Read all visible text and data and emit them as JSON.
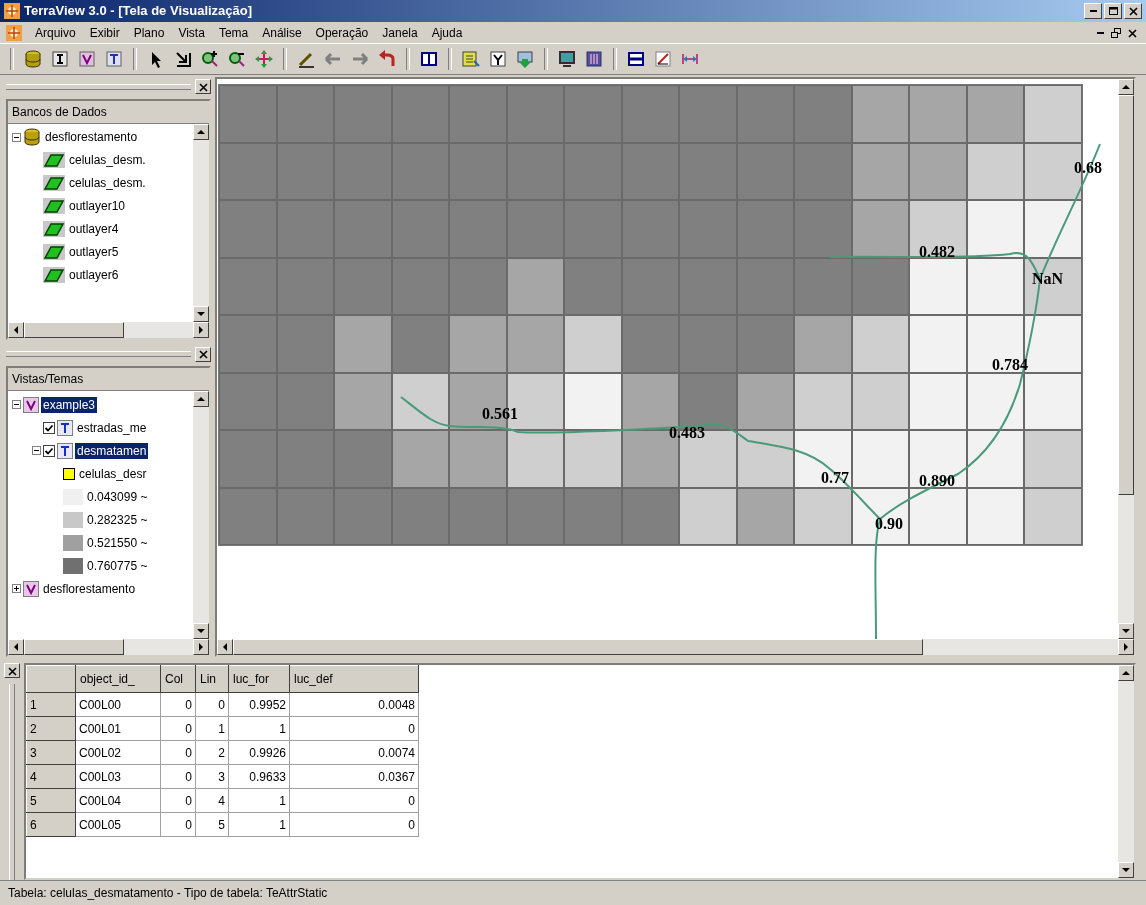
{
  "window": {
    "title": "TerraView 3.0 - [Tela de Visualização]"
  },
  "menu": [
    "Arquivo",
    "Exibir",
    "Plano",
    "Vista",
    "Tema",
    "Análise",
    "Operação",
    "Janela",
    "Ajuda"
  ],
  "databases": {
    "title": "Bancos de Dados",
    "items": [
      {
        "kind": "database",
        "label": "desflorestamento",
        "expanded": true,
        "selected": false,
        "children": [
          {
            "kind": "layer",
            "label": "celulas_desm.",
            "selected": false
          },
          {
            "kind": "layer",
            "label": "celulas_desm.",
            "selected": false
          },
          {
            "kind": "layer",
            "label": "outlayer10",
            "selected": false
          },
          {
            "kind": "layer",
            "label": "outlayer4",
            "selected": false
          },
          {
            "kind": "layer",
            "label": "outlayer5",
            "selected": false
          },
          {
            "kind": "layer",
            "label": "outlayer6",
            "selected": false
          }
        ]
      }
    ]
  },
  "views": {
    "title": "Vistas/Temas",
    "items": [
      {
        "kind": "view",
        "label": "example3",
        "expanded": true,
        "selected": true,
        "children": [
          {
            "kind": "theme",
            "label": "estradas_me",
            "checked": true,
            "selected": false
          },
          {
            "kind": "theme",
            "label": "desmatamen",
            "checked": true,
            "expanded": true,
            "selected": true,
            "children": [
              {
                "kind": "legend",
                "label": "celulas_desr",
                "color": "#ffff00"
              },
              {
                "kind": "legend",
                "label": "0.043099 ~",
                "color": "#f0f0f0"
              },
              {
                "kind": "legend",
                "label": "0.282325 ~",
                "color": "#c8c8c8"
              },
              {
                "kind": "legend",
                "label": "0.521550 ~",
                "color": "#a0a0a0"
              },
              {
                "kind": "legend",
                "label": "0.760775 ~",
                "color": "#707070"
              }
            ]
          }
        ]
      },
      {
        "kind": "view",
        "label": "desflorestamento",
        "expanded": false,
        "selected": false
      }
    ]
  },
  "map": {
    "rows": [
      {
        "cells": [
          {
            "color": "#808080"
          },
          {
            "color": "#808080"
          },
          {
            "color": "#808080"
          },
          {
            "color": "#808080"
          },
          {
            "color": "#808080"
          },
          {
            "color": "#808080"
          },
          {
            "color": "#808080"
          },
          {
            "color": "#808080"
          },
          {
            "color": "#808080"
          },
          {
            "color": "#808080"
          },
          {
            "color": "#808080"
          },
          {
            "color": "#a6a6a6"
          },
          {
            "color": "#a6a6a6"
          },
          {
            "color": "#a6a6a6"
          },
          {
            "color": "#cfcfcf"
          }
        ]
      },
      {
        "cells": [
          {
            "color": "#808080"
          },
          {
            "color": "#808080"
          },
          {
            "color": "#808080"
          },
          {
            "color": "#808080"
          },
          {
            "color": "#808080"
          },
          {
            "color": "#808080"
          },
          {
            "color": "#808080"
          },
          {
            "color": "#808080"
          },
          {
            "color": "#808080"
          },
          {
            "color": "#808080"
          },
          {
            "color": "#808080"
          },
          {
            "color": "#a6a6a6"
          },
          {
            "color": "#a6a6a6"
          },
          {
            "color": "#cfcfcf"
          },
          {
            "color": "#cfcfcf"
          }
        ]
      },
      {
        "cells": [
          {
            "color": "#808080"
          },
          {
            "color": "#808080"
          },
          {
            "color": "#808080"
          },
          {
            "color": "#808080"
          },
          {
            "color": "#808080"
          },
          {
            "color": "#808080"
          },
          {
            "color": "#808080"
          },
          {
            "color": "#808080"
          },
          {
            "color": "#808080"
          },
          {
            "color": "#808080"
          },
          {
            "color": "#808080"
          },
          {
            "color": "#a6a6a6"
          },
          {
            "color": "#cfcfcf"
          },
          {
            "color": "#f2f2f2"
          },
          {
            "color": "#f2f2f2"
          }
        ]
      },
      {
        "cells": [
          {
            "color": "#808080"
          },
          {
            "color": "#808080"
          },
          {
            "color": "#808080"
          },
          {
            "color": "#808080"
          },
          {
            "color": "#808080"
          },
          {
            "color": "#a6a6a6"
          },
          {
            "color": "#808080"
          },
          {
            "color": "#808080"
          },
          {
            "color": "#808080"
          },
          {
            "color": "#808080"
          },
          {
            "color": "#808080"
          },
          {
            "color": "#808080"
          },
          {
            "color": "#f2f2f2"
          },
          {
            "color": "#f2f2f2"
          },
          {
            "color": "#cfcfcf"
          }
        ]
      },
      {
        "cells": [
          {
            "color": "#808080"
          },
          {
            "color": "#808080"
          },
          {
            "color": "#a6a6a6"
          },
          {
            "color": "#808080"
          },
          {
            "color": "#a6a6a6"
          },
          {
            "color": "#a6a6a6"
          },
          {
            "color": "#cfcfcf"
          },
          {
            "color": "#808080"
          },
          {
            "color": "#808080"
          },
          {
            "color": "#808080"
          },
          {
            "color": "#a6a6a6"
          },
          {
            "color": "#cfcfcf"
          },
          {
            "color": "#f2f2f2"
          },
          {
            "color": "#f2f2f2"
          },
          {
            "color": "#f2f2f2"
          }
        ]
      },
      {
        "cells": [
          {
            "color": "#808080"
          },
          {
            "color": "#808080"
          },
          {
            "color": "#a6a6a6"
          },
          {
            "color": "#cfcfcf"
          },
          {
            "color": "#a6a6a6"
          },
          {
            "color": "#cfcfcf"
          },
          {
            "color": "#f2f2f2"
          },
          {
            "color": "#a6a6a6"
          },
          {
            "color": "#808080"
          },
          {
            "color": "#a6a6a6"
          },
          {
            "color": "#cfcfcf"
          },
          {
            "color": "#cfcfcf"
          },
          {
            "color": "#f2f2f2"
          },
          {
            "color": "#f2f2f2"
          },
          {
            "color": "#f2f2f2"
          }
        ]
      },
      {
        "cells": [
          {
            "color": "#808080"
          },
          {
            "color": "#808080"
          },
          {
            "color": "#808080"
          },
          {
            "color": "#a6a6a6"
          },
          {
            "color": "#a6a6a6"
          },
          {
            "color": "#cfcfcf"
          },
          {
            "color": "#cfcfcf"
          },
          {
            "color": "#a6a6a6"
          },
          {
            "color": "#cfcfcf"
          },
          {
            "color": "#cfcfcf"
          },
          {
            "color": "#f2f2f2"
          },
          {
            "color": "#f2f2f2"
          },
          {
            "color": "#f2f2f2"
          },
          {
            "color": "#f2f2f2"
          },
          {
            "color": "#cfcfcf"
          }
        ]
      },
      {
        "cells": [
          {
            "color": "#808080"
          },
          {
            "color": "#808080"
          },
          {
            "color": "#808080"
          },
          {
            "color": "#808080"
          },
          {
            "color": "#808080"
          },
          {
            "color": "#808080"
          },
          {
            "color": "#808080"
          },
          {
            "color": "#808080"
          },
          {
            "color": "#cfcfcf"
          },
          {
            "color": "#a6a6a6"
          },
          {
            "color": "#cfcfcf"
          },
          {
            "color": "#f2f2f2"
          },
          {
            "color": "#f2f2f2"
          },
          {
            "color": "#f2f2f2"
          },
          {
            "color": "#cfcfcf"
          }
        ]
      }
    ],
    "labels": [
      "0.68",
      "0.482",
      "NaN",
      "0.784",
      "0.561",
      "0.483",
      "0.77",
      "0.890",
      "0.90"
    ]
  },
  "table": {
    "columns": [
      "",
      "object_id_",
      "Col",
      "Lin",
      "luc_for",
      "luc_def"
    ],
    "rows": [
      [
        "1",
        "C00L00",
        "0",
        "0",
        "0.9952",
        "0.0048"
      ],
      [
        "2",
        "C00L01",
        "0",
        "1",
        "1",
        "0"
      ],
      [
        "3",
        "C00L02",
        "0",
        "2",
        "0.9926",
        "0.0074"
      ],
      [
        "4",
        "C00L03",
        "0",
        "3",
        "0.9633",
        "0.0367"
      ],
      [
        "5",
        "C00L04",
        "0",
        "4",
        "1",
        "0"
      ],
      [
        "6",
        "C00L05",
        "0",
        "5",
        "1",
        "0"
      ]
    ]
  },
  "status_bar": "Tabela: celulas_desmatamento - Tipo de tabela: TeAttrStatic"
}
